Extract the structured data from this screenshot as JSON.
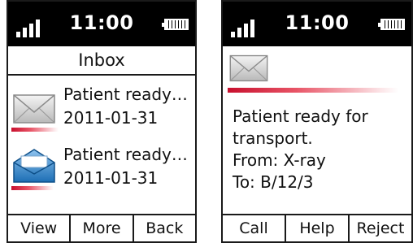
{
  "left_screen": {
    "status": {
      "time": "11:00",
      "signal_icon": "signal-icon",
      "battery_icon": "battery-icon"
    },
    "title": "Inbox",
    "messages": [
      {
        "subject": "Patient ready…",
        "date": "2011-01-31",
        "icon": "envelope-closed-icon"
      },
      {
        "subject": "Patient ready…",
        "date": "2011-01-31",
        "icon": "envelope-open-icon"
      }
    ],
    "softkeys": [
      "View",
      "More",
      "Back"
    ]
  },
  "right_screen": {
    "status": {
      "time": "11:00",
      "signal_icon": "signal-icon",
      "battery_icon": "battery-icon"
    },
    "message_icon": "envelope-closed-icon",
    "body_lines": [
      "Patient ready for",
      "transport.",
      "From: X-ray",
      "To: B/12/3"
    ],
    "softkeys": [
      "Call",
      "Help",
      "Reject"
    ]
  },
  "colors": {
    "accent": "#c8102e",
    "open_envelope": "#1d6fb5",
    "status_bar": "#000000"
  }
}
